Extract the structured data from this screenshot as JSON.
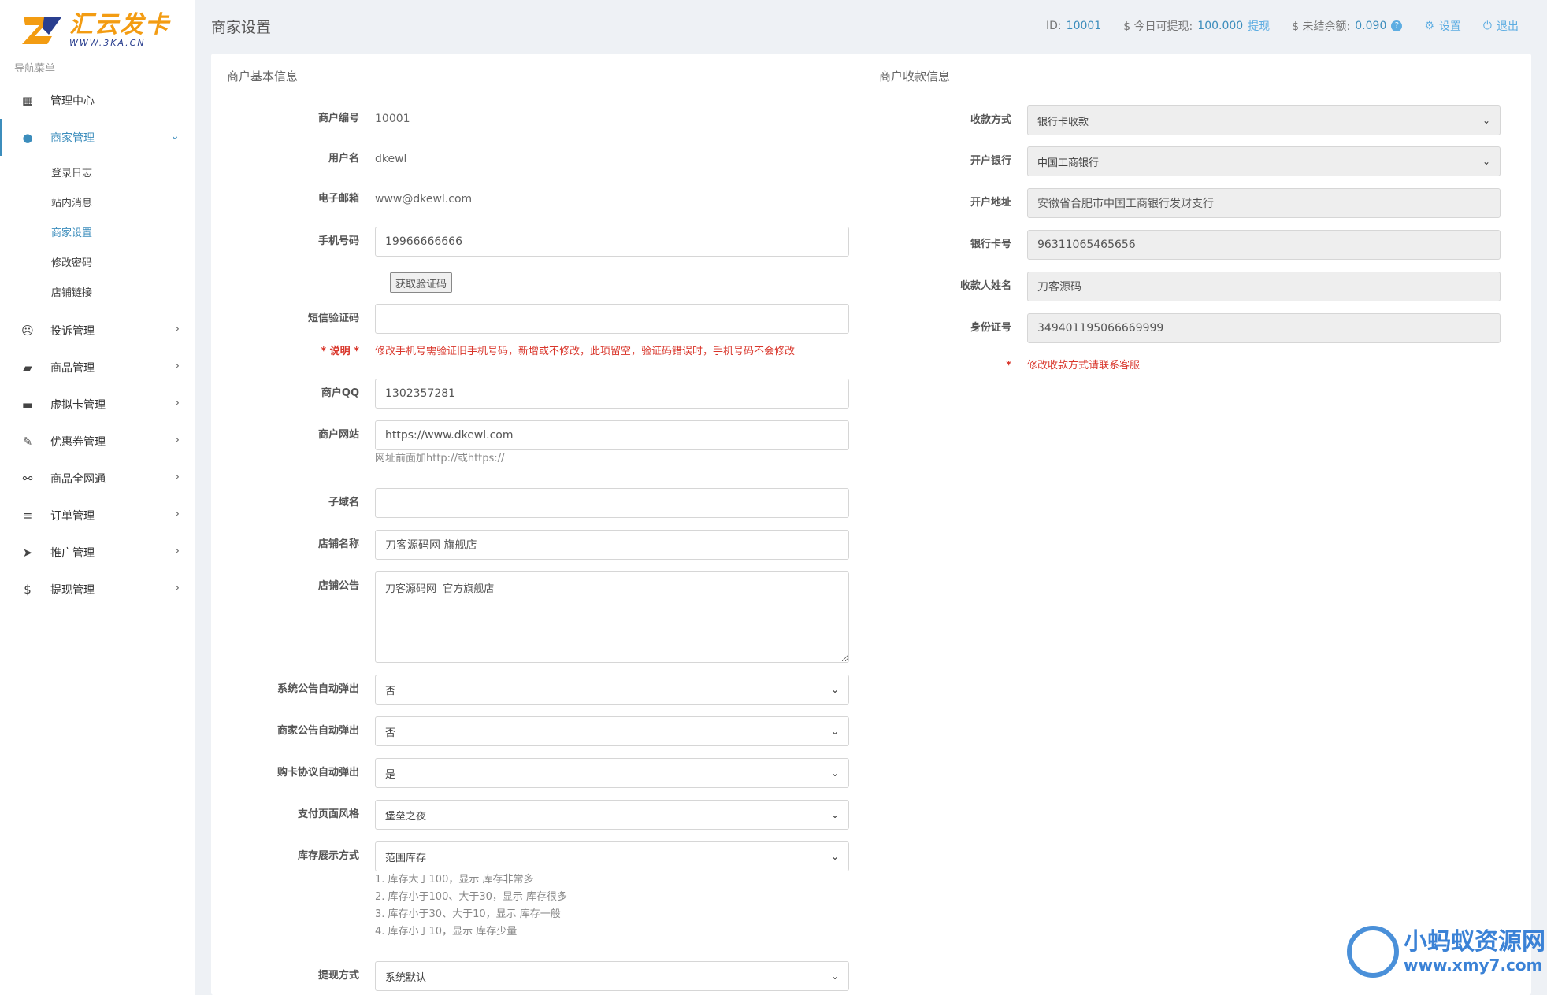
{
  "brand": {
    "title": "汇云发卡",
    "sub": "WWW.3KA.CN"
  },
  "nav_header": "导航菜单",
  "nav": [
    {
      "label": "管理中心",
      "icon": "dashboard-icon",
      "glyph": "▦"
    },
    {
      "label": "商家管理",
      "icon": "user-icon",
      "glyph": "●",
      "active": true,
      "children": [
        {
          "label": "登录日志"
        },
        {
          "label": "站内消息"
        },
        {
          "label": "商家设置",
          "active": true
        },
        {
          "label": "修改密码"
        },
        {
          "label": "店铺链接"
        }
      ]
    },
    {
      "label": "投诉管理",
      "icon": "frown-icon",
      "glyph": "☹"
    },
    {
      "label": "商品管理",
      "icon": "bag-icon",
      "glyph": "▰"
    },
    {
      "label": "虚拟卡管理",
      "icon": "card-icon",
      "glyph": "▬"
    },
    {
      "label": "优惠券管理",
      "icon": "ticket-icon",
      "glyph": "✎"
    },
    {
      "label": "商品全网通",
      "icon": "handshake-icon",
      "glyph": "⚯"
    },
    {
      "label": "订单管理",
      "icon": "list-icon",
      "glyph": "≡"
    },
    {
      "label": "推广管理",
      "icon": "paper-plane-icon",
      "glyph": "➤"
    },
    {
      "label": "提现管理",
      "icon": "dollar-icon",
      "glyph": "$"
    }
  ],
  "topbar": {
    "title": "商家设置",
    "id_label": "ID:",
    "id_value": "10001",
    "withdraw_label": "$ 今日可提现:",
    "withdraw_value": "100.000",
    "withdraw_link": "提现",
    "unsettled_label": "$ 未结余额:",
    "unsettled_value": "0.090",
    "settings_label": "设置",
    "logout_label": "退出"
  },
  "basic": {
    "section_title": "商户基本信息",
    "merchant_id": {
      "label": "商户编号",
      "value": "10001"
    },
    "username": {
      "label": "用户名",
      "value": "dkewl"
    },
    "email": {
      "label": "电子邮箱",
      "value": "www@dkewl.com"
    },
    "phone": {
      "label": "手机号码",
      "value": "19966666666"
    },
    "get_code_btn": "获取验证码",
    "sms_code": {
      "label": "短信验证码",
      "value": ""
    },
    "note": {
      "label": "* 说明 *",
      "text": "修改手机号需验证旧手机号码，新增或不修改，此项留空，验证码错误时，手机号码不会修改"
    },
    "qq": {
      "label": "商户QQ",
      "value": "1302357281"
    },
    "website": {
      "label": "商户网站",
      "value": "https://www.dkewl.com",
      "hint": "网址前面加http://或https://"
    },
    "subdomain": {
      "label": "子域名",
      "value": ""
    },
    "shop_name": {
      "label": "店铺名称",
      "value": "刀客源码网 旗舰店"
    },
    "shop_notice": {
      "label": "店铺公告",
      "value": "刀客源码网  官方旗舰店"
    },
    "sys_popup": {
      "label": "系统公告自动弹出",
      "value": "否"
    },
    "merchant_popup": {
      "label": "商家公告自动弹出",
      "value": "否"
    },
    "agreement_popup": {
      "label": "购卡协议自动弹出",
      "value": "是"
    },
    "pay_style": {
      "label": "支付页面风格",
      "value": "堡垒之夜"
    },
    "stock_display": {
      "label": "库存展示方式",
      "value": "范围库存",
      "hints": [
        "1. 库存大于100，显示 库存非常多",
        "2. 库存小于100、大于30，显示 库存很多",
        "3. 库存小于30、大于10，显示 库存一般",
        "4. 库存小于10，显示 库存少量"
      ]
    },
    "withdraw_method": {
      "label": "提现方式",
      "value": "系统默认"
    }
  },
  "payment": {
    "section_title": "商户收款信息",
    "method": {
      "label": "收款方式",
      "value": "银行卡收款"
    },
    "bank": {
      "label": "开户银行",
      "value": "中国工商银行"
    },
    "address": {
      "label": "开户地址",
      "value": "安徽省合肥市中国工商银行发财支行"
    },
    "card_no": {
      "label": "银行卡号",
      "value": "96311065465656"
    },
    "payee": {
      "label": "收款人姓名",
      "value": "刀客源码"
    },
    "id_no": {
      "label": "身份证号",
      "value": "349401195066669999"
    },
    "note_star": "*",
    "note": "修改收款方式请联系客服"
  },
  "watermark": {
    "title": "小蚂蚁资源网",
    "url": "www.xmy7.com"
  },
  "colors": {
    "accent": "#3c8dbc",
    "brand_orange": "#f39c12",
    "error_red": "#d9362b"
  }
}
